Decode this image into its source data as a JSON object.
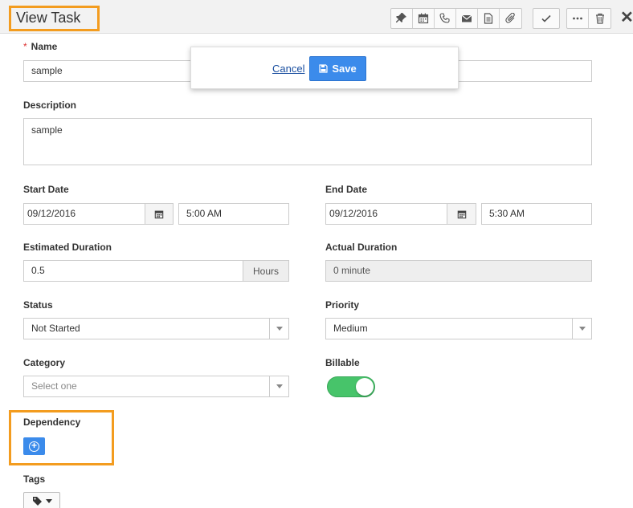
{
  "window": {
    "title": "View Task"
  },
  "popover": {
    "cancel_label": "Cancel",
    "save_label": "Save"
  },
  "form": {
    "name": {
      "label": "Name",
      "value": "sample"
    },
    "description": {
      "label": "Description",
      "value": "sample"
    },
    "start_date": {
      "label": "Start Date",
      "date": "09/12/2016",
      "time": "5:00 AM"
    },
    "end_date": {
      "label": "End Date",
      "date": "09/12/2016",
      "time": "5:30 AM"
    },
    "estimated_duration": {
      "label": "Estimated Duration",
      "value": "0.5",
      "unit": "Hours"
    },
    "actual_duration": {
      "label": "Actual Duration",
      "value": "0 minute"
    },
    "status": {
      "label": "Status",
      "value": "Not Started"
    },
    "priority": {
      "label": "Priority",
      "value": "Medium"
    },
    "category": {
      "label": "Category",
      "placeholder": "Select one"
    },
    "billable": {
      "label": "Billable",
      "on": true
    },
    "dependency": {
      "label": "Dependency"
    },
    "tags": {
      "label": "Tags"
    }
  },
  "toolbar": {
    "icons": [
      "pin-icon",
      "calendar-icon",
      "phone-icon",
      "mail-icon",
      "document-icon",
      "paperclip-icon",
      "check-icon",
      "more-icon",
      "trash-icon",
      "close-icon"
    ]
  },
  "colors": {
    "accent": "#3b8beb",
    "toggle_on": "#47c46a",
    "highlight": "#f39c1f"
  }
}
